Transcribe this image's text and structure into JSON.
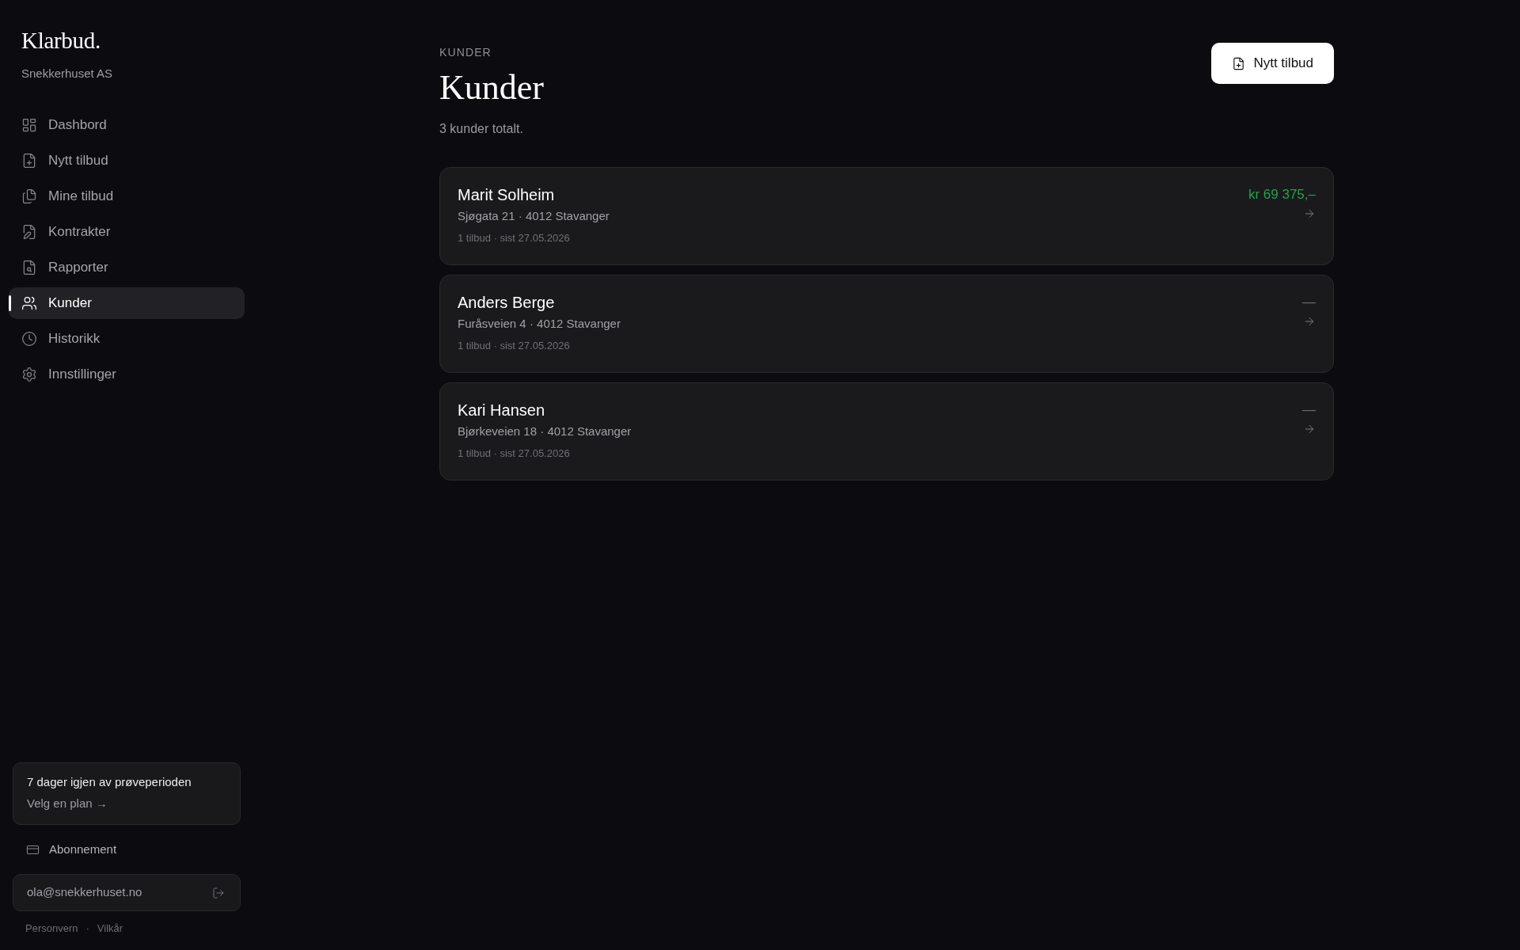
{
  "sidebar": {
    "logo": "Klarbud.",
    "company": "Snekkerhuset AS",
    "nav_items": [
      {
        "label": "Dashbord",
        "selected": false
      },
      {
        "label": "Nytt tilbud",
        "selected": false
      },
      {
        "label": "Mine tilbud",
        "selected": false
      },
      {
        "label": "Kontrakter",
        "selected": false
      },
      {
        "label": "Rapporter",
        "selected": false
      },
      {
        "label": "Kunder",
        "selected": true
      },
      {
        "label": "Historikk",
        "selected": false
      },
      {
        "label": "Innstillinger",
        "selected": false
      }
    ],
    "trial_card": {
      "title": "7 dager igjen av prøveperioden",
      "link": "Velg en plan →"
    },
    "subscription_link": "Abonnement",
    "account": {
      "email": "ola@snekkerhuset.no"
    },
    "footer_links": [
      "Personvern",
      "Vilkår"
    ],
    "footer_separator": "·"
  },
  "header": {
    "eyebrow": "KUNDER",
    "title": "Kunder",
    "summary": "3 kunder totalt.",
    "new_quote_button": "Nytt tilbud"
  },
  "customers": [
    {
      "name": "Marit Solheim",
      "address": "Sjøgata 21 · 4012 Stavanger",
      "meta": "1 tilbud · sist 27.05.2026",
      "total": {
        "kind": "amount",
        "text": "kr 69 375,–"
      }
    },
    {
      "name": "Anders Berge",
      "address": "Furåsveien 4 · 4012 Stavanger",
      "meta": "1 tilbud · sist 27.05.2026",
      "total": {
        "kind": "empty",
        "text": "—"
      }
    },
    {
      "name": "Kari Hansen",
      "address": "Bjørkeveien 18 · 4012 Stavanger",
      "meta": "1 tilbud · sist 27.05.2026",
      "total": {
        "kind": "empty",
        "text": "—"
      }
    }
  ]
}
